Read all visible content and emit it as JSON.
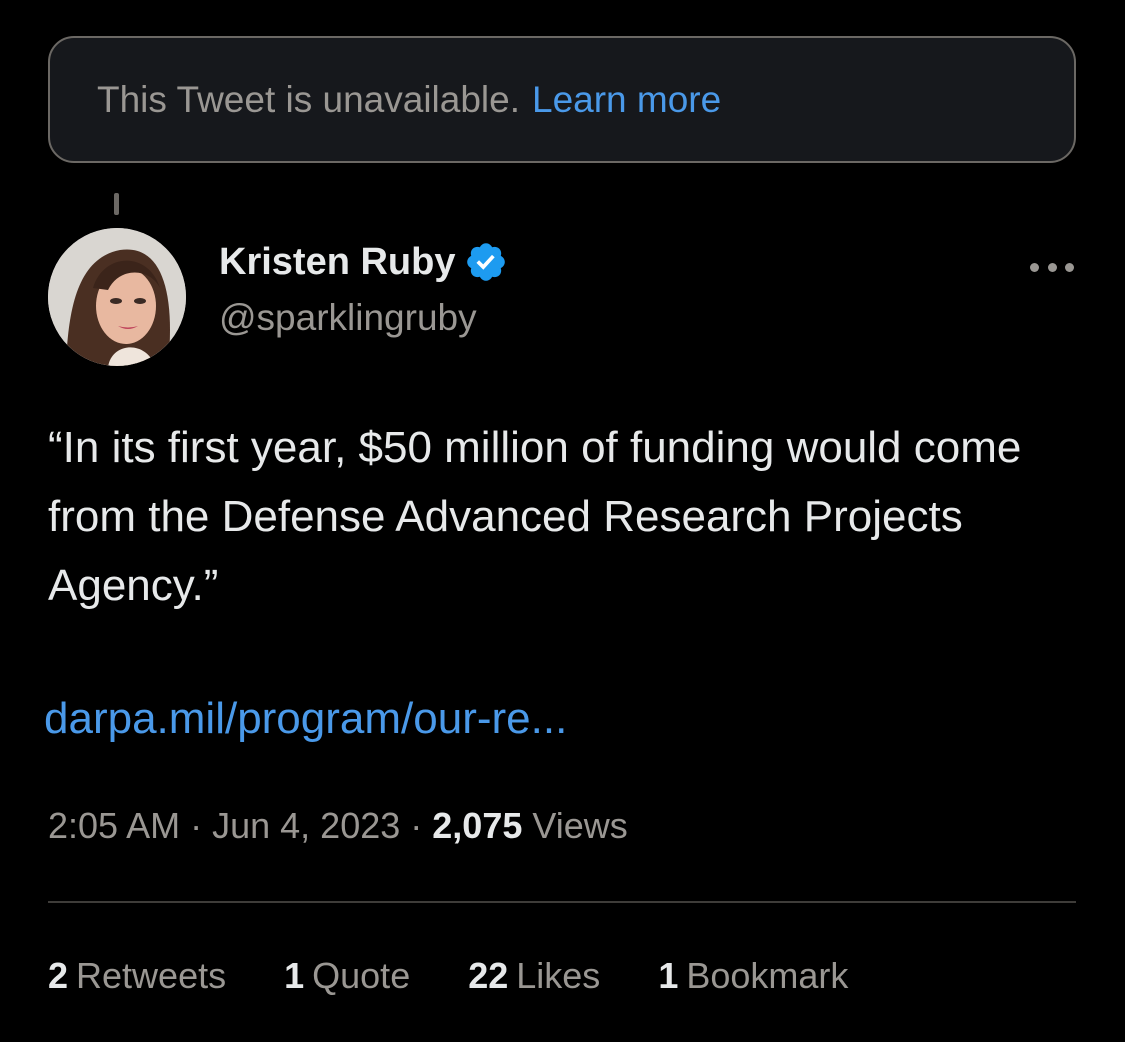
{
  "unavailable_notice": {
    "text": "This Tweet is unavailable.",
    "link": "Learn more"
  },
  "author": {
    "display_name": "Kristen Ruby",
    "handle": "@sparklingruby",
    "verified": true
  },
  "tweet": {
    "text": "“In its first year, $50 million of funding would come from the Defense Advanced Research Projects Agency.”",
    "link": "darpa.mil/program/our-re..."
  },
  "meta": {
    "time": "2:05 AM",
    "separator": "·",
    "date": "Jun 4, 2023",
    "views_count": "2,075",
    "views_label": "Views"
  },
  "stats": [
    {
      "count": "2",
      "label": "Retweets"
    },
    {
      "count": "1",
      "label": "Quote"
    },
    {
      "count": "22",
      "label": "Likes"
    },
    {
      "count": "1",
      "label": "Bookmark"
    }
  ],
  "colors": {
    "background": "#000000",
    "accent": "#4a99e9",
    "text_primary": "#e7e9ea",
    "text_secondary": "#9a9793",
    "verified_badge": "#1d9bf0"
  },
  "icons": {
    "verified": "verified-badge-icon",
    "more": "more-options-icon"
  }
}
